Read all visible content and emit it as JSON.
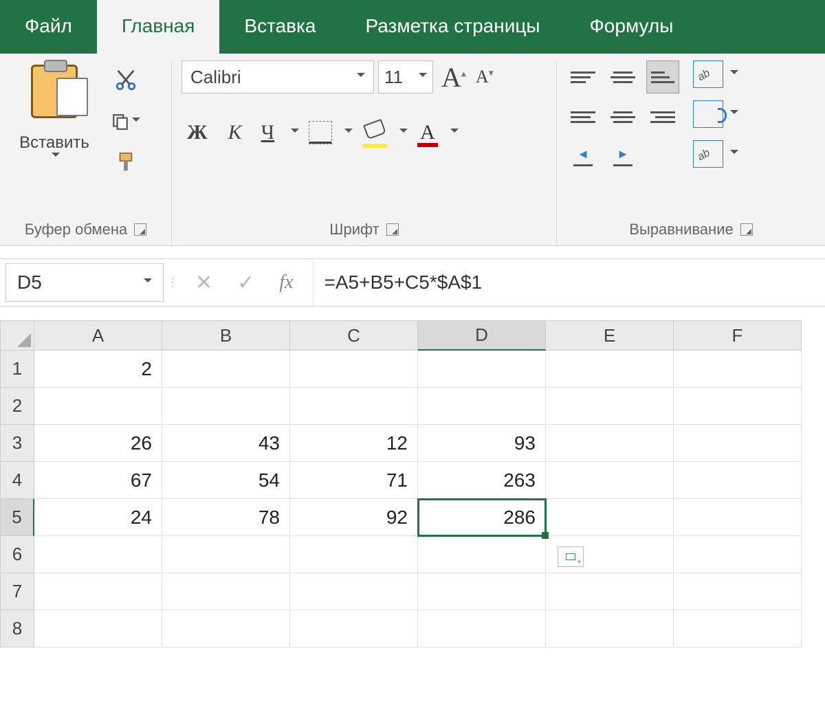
{
  "tabs": {
    "file": "Файл",
    "home": "Главная",
    "insert": "Вставка",
    "pagelayout": "Разметка страницы",
    "formulas": "Формулы"
  },
  "ribbon": {
    "clipboard": {
      "paste": "Вставить",
      "label": "Буфер обмена"
    },
    "font": {
      "name": "Calibri",
      "size": "11",
      "bold": "Ж",
      "italic": "К",
      "underline": "Ч",
      "label": "Шрифт"
    },
    "alignment": {
      "label": "Выравнивание"
    }
  },
  "formula_bar": {
    "name_box": "D5",
    "fx": "fx",
    "formula": "=A5+B5+C5*$A$1"
  },
  "grid": {
    "columns": [
      "A",
      "B",
      "C",
      "D",
      "E",
      "F"
    ],
    "rows": [
      "1",
      "2",
      "3",
      "4",
      "5",
      "6",
      "7",
      "8"
    ],
    "selected_col": "D",
    "selected_row": "5",
    "cells": {
      "A1": "2",
      "A3": "26",
      "B3": "43",
      "C3": "12",
      "D3": "93",
      "A4": "67",
      "B4": "54",
      "C4": "71",
      "D4": "263",
      "A5": "24",
      "B5": "78",
      "C5": "92",
      "D5": "286"
    }
  }
}
